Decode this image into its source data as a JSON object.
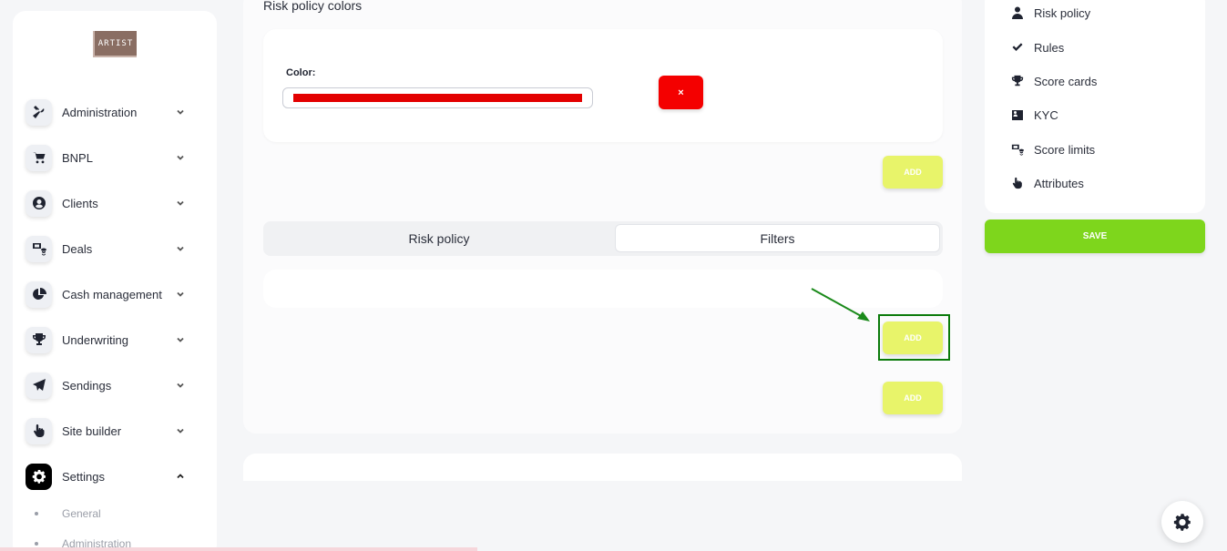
{
  "brand": {
    "logo_text": "ARTIST"
  },
  "sidebar": {
    "items": [
      {
        "label": "Administration",
        "icon": "tools-icon"
      },
      {
        "label": "BNPL",
        "icon": "cart-icon"
      },
      {
        "label": "Clients",
        "icon": "user-circle-icon"
      },
      {
        "label": "Deals",
        "icon": "deals-icon"
      },
      {
        "label": "Cash management",
        "icon": "pie-chart-icon"
      },
      {
        "label": "Underwriting",
        "icon": "trophy-icon"
      },
      {
        "label": "Sendings",
        "icon": "paper-plane-icon"
      },
      {
        "label": "Site builder",
        "icon": "pointer-hand-icon"
      },
      {
        "label": "Settings",
        "icon": "gear-icon",
        "active": true,
        "expanded": true
      }
    ],
    "sub_items": [
      "General",
      "Administration"
    ]
  },
  "main": {
    "section_title": "Risk policy colors",
    "color_label": "Color:",
    "color_value_hex": "#e30000",
    "remove_label": "×",
    "add_label": "ADD",
    "tabs": [
      {
        "label": "Risk policy",
        "active": false
      },
      {
        "label": "Filters",
        "active": true
      }
    ]
  },
  "right_panel": {
    "items": [
      {
        "label": "Risk policy",
        "icon": "user-icon"
      },
      {
        "label": "Rules",
        "icon": "check-icon"
      },
      {
        "label": "Score cards",
        "icon": "trophy-icon"
      },
      {
        "label": "KYC",
        "icon": "id-card-icon"
      },
      {
        "label": "Score limits",
        "icon": "deals-icon"
      },
      {
        "label": "Attributes",
        "icon": "pointer-hand-icon"
      }
    ],
    "save_label": "SAVE"
  },
  "colors": {
    "accent_yellow": "#e8f46a",
    "save_green": "#7ed61c",
    "remove_red": "#f40000",
    "highlight_green": "#0a7a0a"
  }
}
